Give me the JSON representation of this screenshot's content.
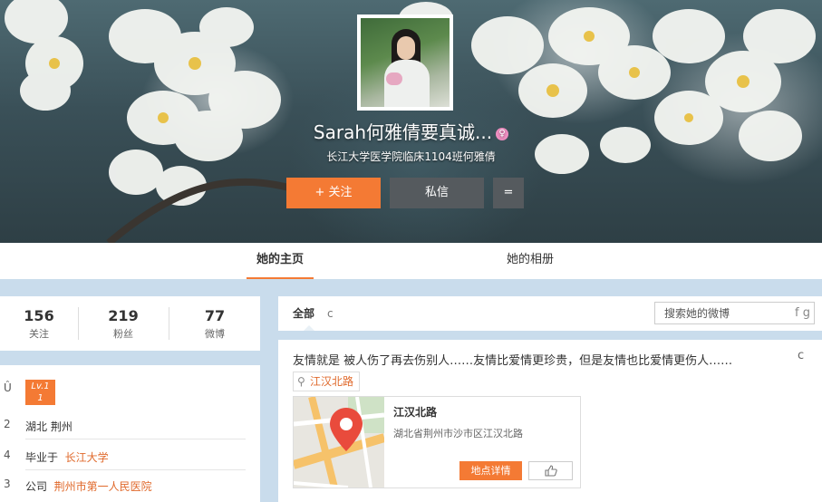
{
  "profile": {
    "name": "Sarah何雅倩要真诚...",
    "gender_icon": "female-icon",
    "description": "长江大学医学院临床1104班何雅倩",
    "follow_label": "+ 关注",
    "message_label": "私信",
    "more_label": "="
  },
  "tabs": [
    {
      "label": "她的主页",
      "active": true
    },
    {
      "label": "她的相册",
      "active": false
    }
  ],
  "stats": [
    {
      "value": "156",
      "label": "关注"
    },
    {
      "value": "219",
      "label": "粉丝"
    },
    {
      "value": "77",
      "label": "微博"
    }
  ],
  "info": {
    "level_icon_glyph": "Û",
    "level_badge": "Lv.1\n1",
    "location_icon_glyph": "2",
    "location": "湖北 荆州",
    "school_icon_glyph": "4",
    "school_prefix": "毕业于",
    "school": "长江大学",
    "company_icon_glyph": "3",
    "company_prefix": "公司",
    "company": "荆州市第一人民医院"
  },
  "feed": {
    "filter_all": "全部",
    "filter_icon_glyph": "c",
    "search_placeholder": "搜索她的微博",
    "search_icon_glyph": "f g"
  },
  "post": {
    "text": "友情就是 被人伤了再去伤别人……友情比爱情更珍贵，但是友情也比爱情更伤人……",
    "menu_glyph": "c",
    "location_tag": "江汉北路",
    "card_title": "江汉北路",
    "card_address": "湖北省荆州市沙市区江汉北路",
    "detail_button": "地点详情",
    "like_icon": "thumbs-up-icon"
  },
  "colors": {
    "accent": "#f47a34",
    "dark_button": "#555a5e",
    "page_bg": "#c9dcec"
  }
}
